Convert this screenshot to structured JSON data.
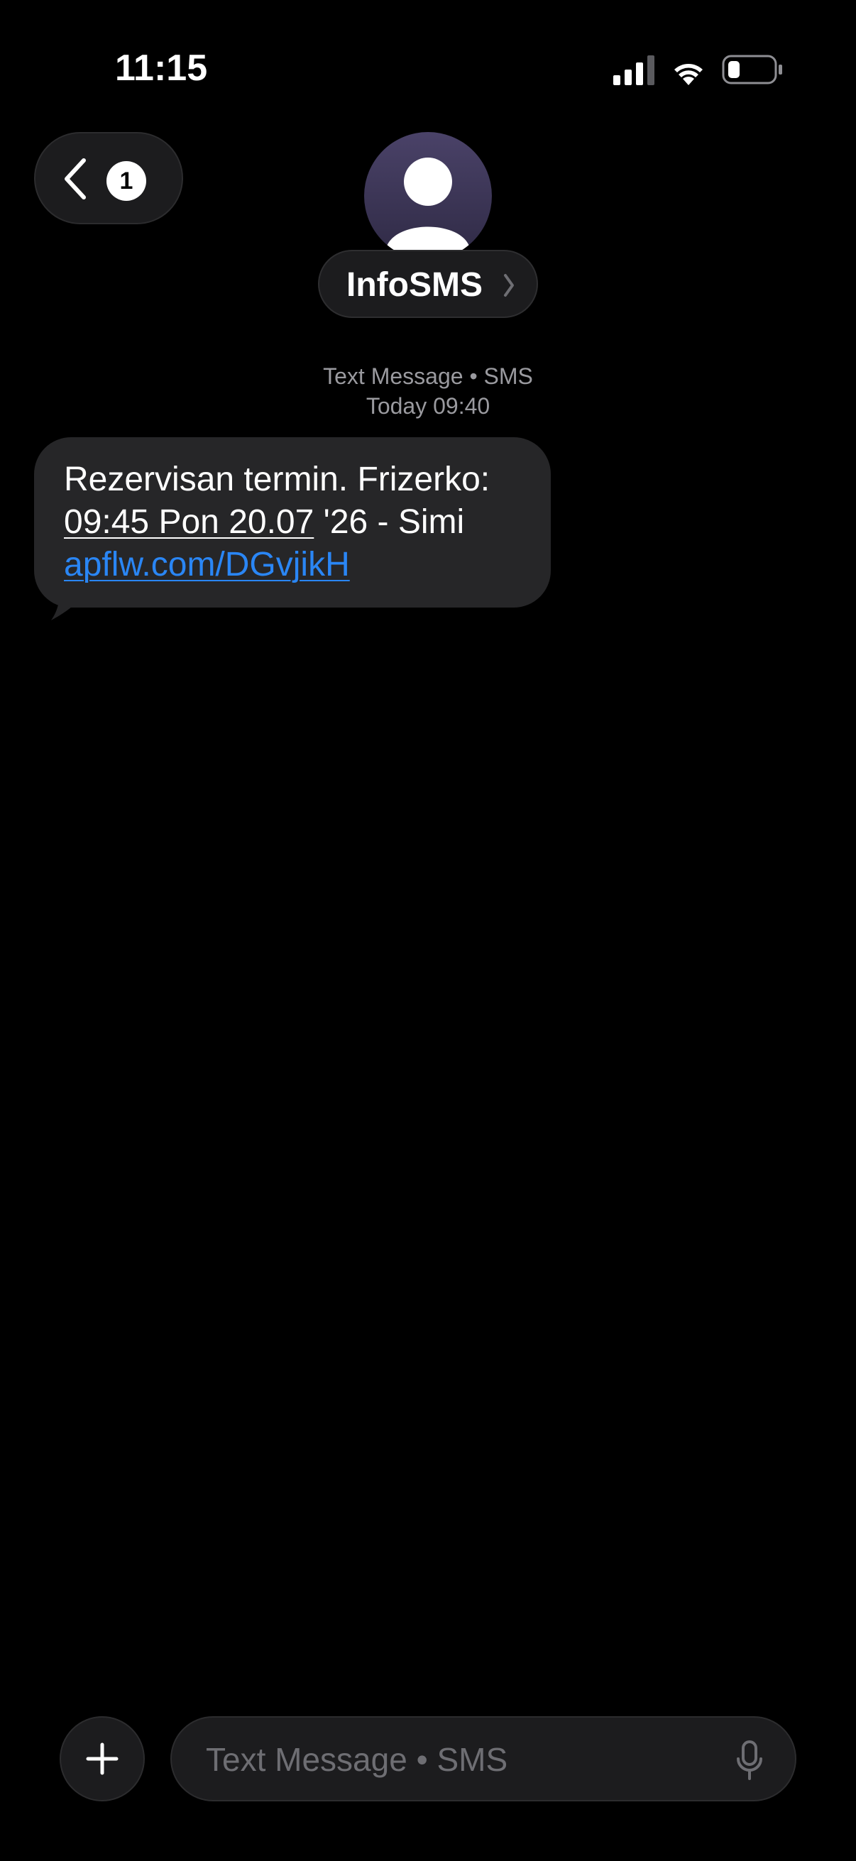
{
  "status_bar": {
    "time": "11:15",
    "icons": [
      "cellular-signal-icon",
      "wifi-icon",
      "battery-icon"
    ]
  },
  "nav": {
    "back_badge_count": "1",
    "contact_name": "InfoSMS"
  },
  "conversation": {
    "meta_type": "Text Message • SMS",
    "meta_time": "Today 09:40",
    "messages": [
      {
        "line1": "Rezervisan termin. Frizerko:",
        "date_link": "09:45 Pon 20.07",
        "line2_rest": " '26 - Simi",
        "url": "apflw.com/DGvjikH"
      }
    ]
  },
  "composer": {
    "placeholder": "Text Message • SMS"
  },
  "colors": {
    "background": "#000000",
    "bubble": "#262628",
    "link": "#2a86f5",
    "meta_text": "#9a9a9f"
  }
}
